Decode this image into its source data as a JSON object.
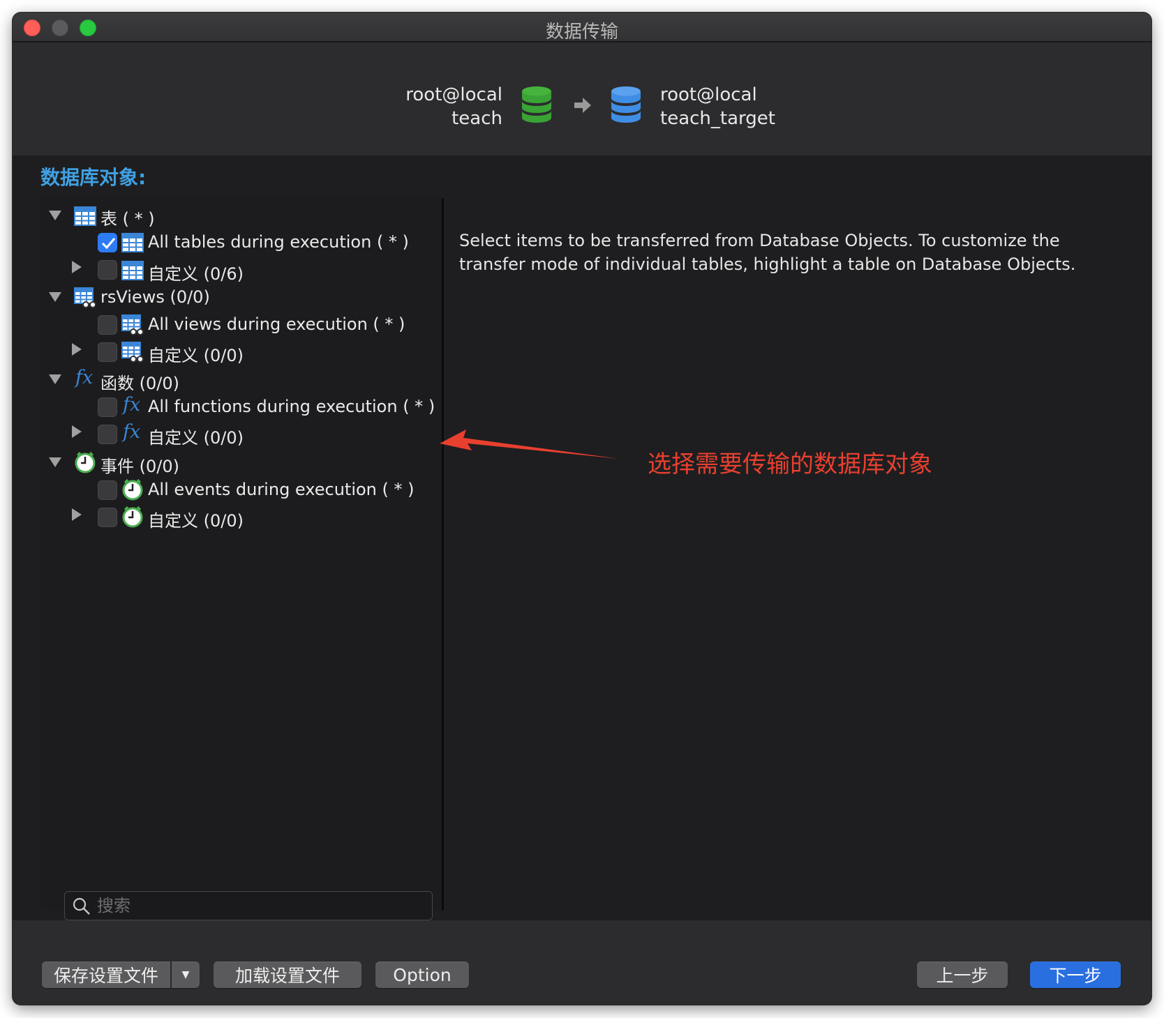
{
  "window": {
    "title": "数据传输"
  },
  "connection": {
    "source": {
      "server": "root@local",
      "database": "teach",
      "icon": "database-green-icon",
      "color": "#3aa335"
    },
    "target": {
      "server": "root@local",
      "database": "teach_target",
      "icon": "database-blue-icon",
      "color": "#3f8ee6"
    },
    "arrow_icon": "right-arrow-icon"
  },
  "section_label": "数据库对象:",
  "tree": {
    "tables": {
      "label": "表 ( * )",
      "icon": "table-icon",
      "all": {
        "label": "All tables during execution ( * )",
        "checked": true
      },
      "custom": {
        "label": "自定义 (0/6)",
        "checked": false
      }
    },
    "views": {
      "label": "rsViews (0/0)",
      "icon": "view-icon",
      "all": {
        "label": "All views during execution ( * )",
        "checked": false
      },
      "custom": {
        "label": "自定义 (0/0)",
        "checked": false
      }
    },
    "functions": {
      "label": "函数 (0/0)",
      "icon": "function-icon",
      "glyph": "fx",
      "all": {
        "label": "All functions during execution ( * )",
        "checked": false
      },
      "custom": {
        "label": "自定义 (0/0)",
        "checked": false
      }
    },
    "events": {
      "label": "事件 (0/0)",
      "icon": "clock-icon",
      "all": {
        "label": "All events during execution ( * )",
        "checked": false
      },
      "custom": {
        "label": "自定义 (0/0)",
        "checked": false
      }
    }
  },
  "search": {
    "placeholder": "搜索",
    "value": ""
  },
  "description": "Select items to be transferred from Database Objects. To customize the transfer mode of individual tables, highlight a table on Database Objects.",
  "annotation": {
    "text": "选择需要传输的数据库对象",
    "color": "#e8402f"
  },
  "footer": {
    "save_label": "保存设置文件",
    "load_label": "加载设置文件",
    "option_label": "Option",
    "prev_label": "上一步",
    "next_label": "下一步"
  },
  "colors": {
    "accent": "#2d7cf6",
    "section_label": "#3fa0e2"
  }
}
